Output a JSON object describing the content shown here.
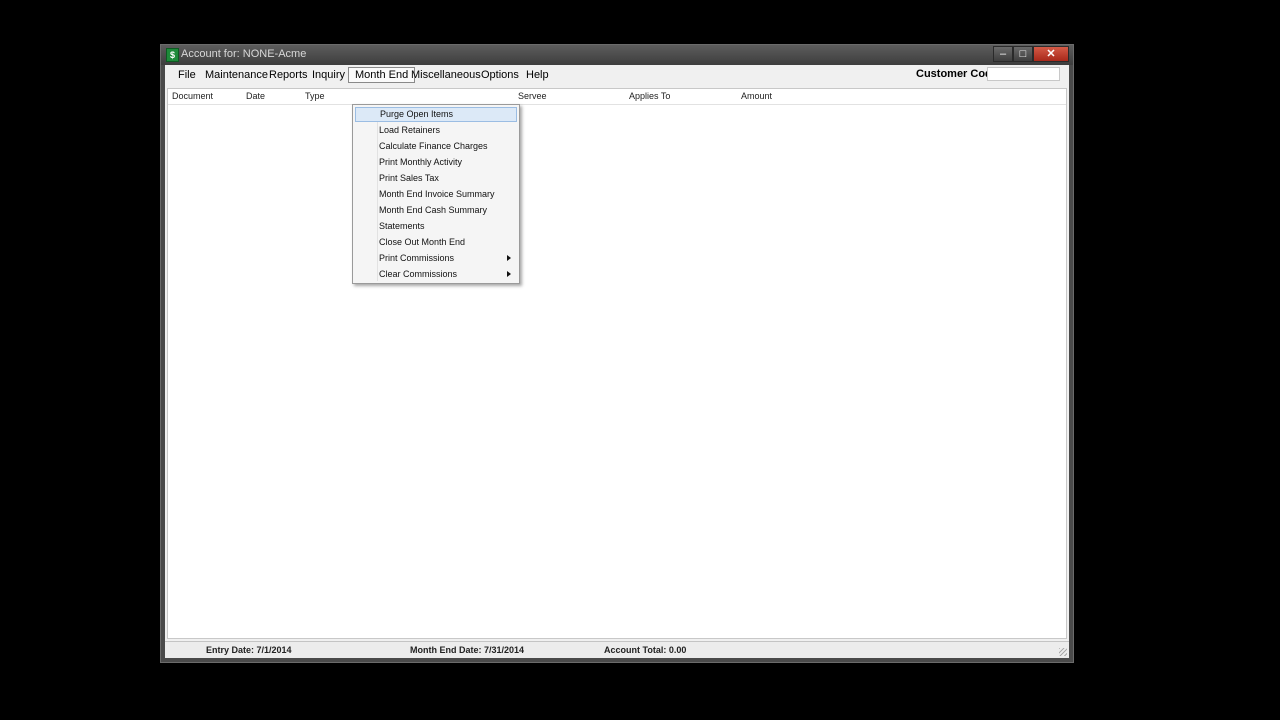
{
  "window": {
    "title": "Account for: NONE-Acme",
    "app_icon": "ledger-icon"
  },
  "menu": {
    "file": "File",
    "maintenance": "Maintenance",
    "reports": "Reports",
    "inquiry": "Inquiry",
    "month_end": "Month End",
    "miscellaneous": "Miscellaneous",
    "options": "Options",
    "help": "Help"
  },
  "customer": {
    "label": "Customer Code:",
    "value": ""
  },
  "grid": {
    "columns": [
      "Document",
      "Date",
      "Type",
      "Servee",
      "Applies To",
      "Amount"
    ]
  },
  "dropdown": {
    "items": [
      "Purge Open Items",
      "Load Retainers",
      "Calculate Finance Charges",
      "Print Monthly Activity",
      "Print Sales Tax",
      "Month End Invoice Summary",
      "Month End Cash Summary",
      "Statements",
      "Close Out Month End",
      "Print Commissions",
      "Clear Commissions"
    ],
    "highlighted": "Purge Open Items"
  },
  "status": {
    "entry_date": "Entry Date: 7/1/2014",
    "month_end_date": "Month End Date: 7/31/2014",
    "account_total": "Account Total: 0.00"
  }
}
